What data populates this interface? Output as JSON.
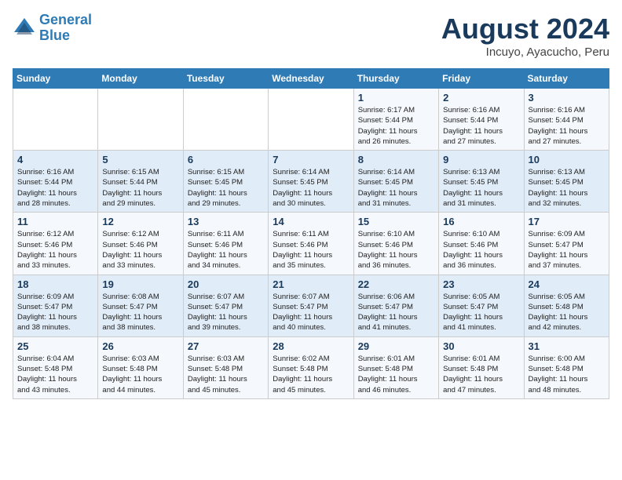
{
  "header": {
    "logo_line1": "General",
    "logo_line2": "Blue",
    "month": "August 2024",
    "location": "Incuyo, Ayacucho, Peru"
  },
  "weekdays": [
    "Sunday",
    "Monday",
    "Tuesday",
    "Wednesday",
    "Thursday",
    "Friday",
    "Saturday"
  ],
  "weeks": [
    [
      {
        "day": "",
        "info": ""
      },
      {
        "day": "",
        "info": ""
      },
      {
        "day": "",
        "info": ""
      },
      {
        "day": "",
        "info": ""
      },
      {
        "day": "1",
        "info": "Sunrise: 6:17 AM\nSunset: 5:44 PM\nDaylight: 11 hours\nand 26 minutes."
      },
      {
        "day": "2",
        "info": "Sunrise: 6:16 AM\nSunset: 5:44 PM\nDaylight: 11 hours\nand 27 minutes."
      },
      {
        "day": "3",
        "info": "Sunrise: 6:16 AM\nSunset: 5:44 PM\nDaylight: 11 hours\nand 27 minutes."
      }
    ],
    [
      {
        "day": "4",
        "info": "Sunrise: 6:16 AM\nSunset: 5:44 PM\nDaylight: 11 hours\nand 28 minutes."
      },
      {
        "day": "5",
        "info": "Sunrise: 6:15 AM\nSunset: 5:44 PM\nDaylight: 11 hours\nand 29 minutes."
      },
      {
        "day": "6",
        "info": "Sunrise: 6:15 AM\nSunset: 5:45 PM\nDaylight: 11 hours\nand 29 minutes."
      },
      {
        "day": "7",
        "info": "Sunrise: 6:14 AM\nSunset: 5:45 PM\nDaylight: 11 hours\nand 30 minutes."
      },
      {
        "day": "8",
        "info": "Sunrise: 6:14 AM\nSunset: 5:45 PM\nDaylight: 11 hours\nand 31 minutes."
      },
      {
        "day": "9",
        "info": "Sunrise: 6:13 AM\nSunset: 5:45 PM\nDaylight: 11 hours\nand 31 minutes."
      },
      {
        "day": "10",
        "info": "Sunrise: 6:13 AM\nSunset: 5:45 PM\nDaylight: 11 hours\nand 32 minutes."
      }
    ],
    [
      {
        "day": "11",
        "info": "Sunrise: 6:12 AM\nSunset: 5:46 PM\nDaylight: 11 hours\nand 33 minutes."
      },
      {
        "day": "12",
        "info": "Sunrise: 6:12 AM\nSunset: 5:46 PM\nDaylight: 11 hours\nand 33 minutes."
      },
      {
        "day": "13",
        "info": "Sunrise: 6:11 AM\nSunset: 5:46 PM\nDaylight: 11 hours\nand 34 minutes."
      },
      {
        "day": "14",
        "info": "Sunrise: 6:11 AM\nSunset: 5:46 PM\nDaylight: 11 hours\nand 35 minutes."
      },
      {
        "day": "15",
        "info": "Sunrise: 6:10 AM\nSunset: 5:46 PM\nDaylight: 11 hours\nand 36 minutes."
      },
      {
        "day": "16",
        "info": "Sunrise: 6:10 AM\nSunset: 5:46 PM\nDaylight: 11 hours\nand 36 minutes."
      },
      {
        "day": "17",
        "info": "Sunrise: 6:09 AM\nSunset: 5:47 PM\nDaylight: 11 hours\nand 37 minutes."
      }
    ],
    [
      {
        "day": "18",
        "info": "Sunrise: 6:09 AM\nSunset: 5:47 PM\nDaylight: 11 hours\nand 38 minutes."
      },
      {
        "day": "19",
        "info": "Sunrise: 6:08 AM\nSunset: 5:47 PM\nDaylight: 11 hours\nand 38 minutes."
      },
      {
        "day": "20",
        "info": "Sunrise: 6:07 AM\nSunset: 5:47 PM\nDaylight: 11 hours\nand 39 minutes."
      },
      {
        "day": "21",
        "info": "Sunrise: 6:07 AM\nSunset: 5:47 PM\nDaylight: 11 hours\nand 40 minutes."
      },
      {
        "day": "22",
        "info": "Sunrise: 6:06 AM\nSunset: 5:47 PM\nDaylight: 11 hours\nand 41 minutes."
      },
      {
        "day": "23",
        "info": "Sunrise: 6:05 AM\nSunset: 5:47 PM\nDaylight: 11 hours\nand 41 minutes."
      },
      {
        "day": "24",
        "info": "Sunrise: 6:05 AM\nSunset: 5:48 PM\nDaylight: 11 hours\nand 42 minutes."
      }
    ],
    [
      {
        "day": "25",
        "info": "Sunrise: 6:04 AM\nSunset: 5:48 PM\nDaylight: 11 hours\nand 43 minutes."
      },
      {
        "day": "26",
        "info": "Sunrise: 6:03 AM\nSunset: 5:48 PM\nDaylight: 11 hours\nand 44 minutes."
      },
      {
        "day": "27",
        "info": "Sunrise: 6:03 AM\nSunset: 5:48 PM\nDaylight: 11 hours\nand 45 minutes."
      },
      {
        "day": "28",
        "info": "Sunrise: 6:02 AM\nSunset: 5:48 PM\nDaylight: 11 hours\nand 45 minutes."
      },
      {
        "day": "29",
        "info": "Sunrise: 6:01 AM\nSunset: 5:48 PM\nDaylight: 11 hours\nand 46 minutes."
      },
      {
        "day": "30",
        "info": "Sunrise: 6:01 AM\nSunset: 5:48 PM\nDaylight: 11 hours\nand 47 minutes."
      },
      {
        "day": "31",
        "info": "Sunrise: 6:00 AM\nSunset: 5:48 PM\nDaylight: 11 hours\nand 48 minutes."
      }
    ]
  ]
}
